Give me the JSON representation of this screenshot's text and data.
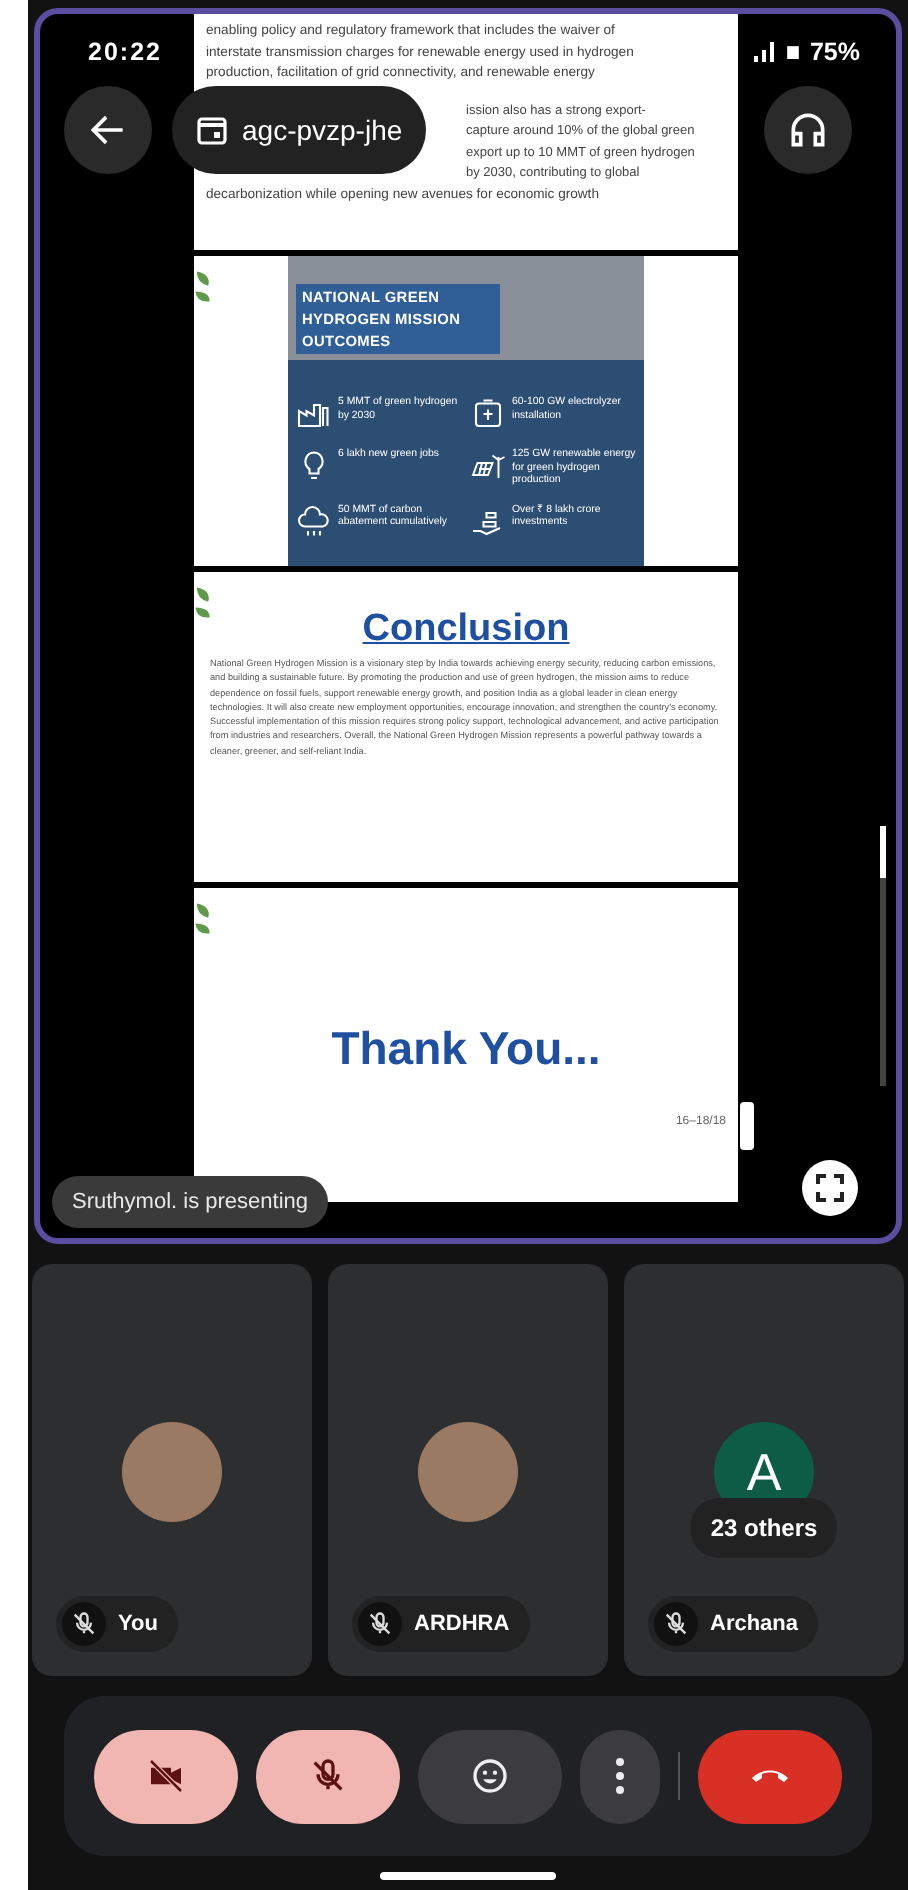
{
  "status_bar": {
    "time": "20:22",
    "battery": "75%"
  },
  "meeting": {
    "code": "agc-pvzp-jhe"
  },
  "presentation": {
    "presenter_label": "Sruthymol. is presenting",
    "slides": [
      {
        "kind": "text",
        "lines_above": [
          "enabling policy and regulatory framework that includes the waiver of",
          "interstate transmission charges for renewable energy used in hydrogen",
          "production, facilitation of grid connectivity, and renewable energy"
        ],
        "lines_beside": [
          "ission also has a strong export-",
          "capture around 10% of the global green",
          "export up to 10 MMT of green hydrogen",
          "by 2030, contributing to global"
        ],
        "lines_below": [
          "decarbonization while opening new avenues for economic growth"
        ]
      },
      {
        "kind": "infographic",
        "title": "NATIONAL GREEN HYDROGEN MISSION OUTCOMES",
        "items": [
          "5 MMT of green hydrogen by 2030",
          "60-100 GW electrolyzer installation",
          "6 lakh new green jobs",
          "125 GW renewable energy for green hydrogen production",
          "50 MMT of carbon abatement cumulatively",
          "Over ₹ 8 lakh crore investments"
        ]
      },
      {
        "kind": "heading_text",
        "heading": "Conclusion",
        "body": "National Green Hydrogen Mission is a visionary step by India towards achieving energy security, reducing carbon emissions, and building a sustainable future. By promoting the production and use of green hydrogen, the mission aims to reduce dependence on fossil fuels, support renewable energy growth, and position India as a global leader in clean energy technologies. It will also create new employment opportunities, encourage innovation, and strengthen the country's economy. Successful implementation of this mission requires strong policy support, technological advancement, and active participation from industries and researchers. Overall, the National Green Hydrogen Mission represents a powerful pathway towards a cleaner, greener, and self-reliant India."
      },
      {
        "kind": "closing",
        "heading": "Thank You...",
        "page": "16–18/18"
      }
    ]
  },
  "participants": [
    {
      "name": "You",
      "kind": "photo",
      "muted": true
    },
    {
      "name": "ARDHRA",
      "kind": "photo",
      "muted": true
    },
    {
      "name": "Archana",
      "kind": "letter",
      "initial": "A",
      "muted": true,
      "others": "23 others"
    }
  ],
  "controls": [
    {
      "kind": "camera",
      "on": false
    },
    {
      "kind": "mic",
      "on": false
    },
    {
      "kind": "reactions"
    },
    {
      "kind": "more"
    },
    {
      "kind": "end"
    }
  ]
}
